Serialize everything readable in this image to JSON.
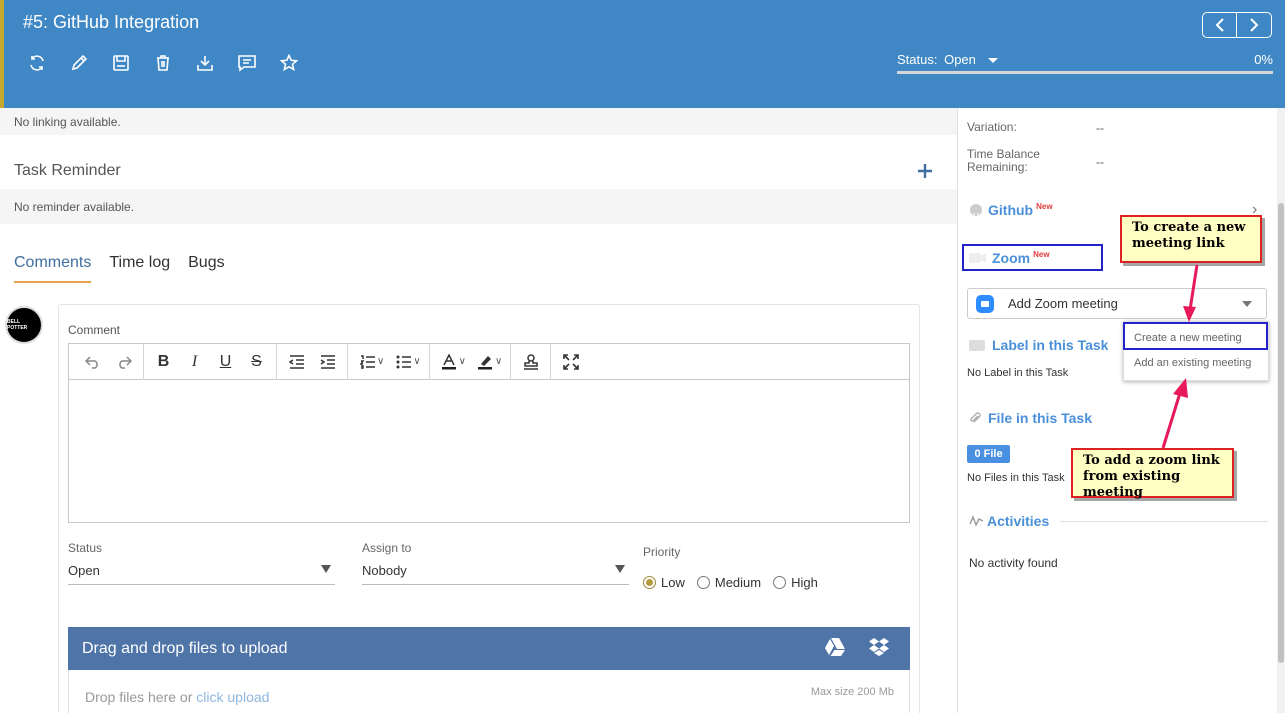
{
  "header": {
    "title": "#5: GitHub Integration",
    "toolbar_icons": [
      "refresh-icon",
      "edit-icon",
      "save-icon",
      "delete-icon",
      "download-icon",
      "comment-icon",
      "star-icon"
    ],
    "status_label": "Status:",
    "status_value": "Open",
    "progress_text": "0%",
    "progress_fraction": 0,
    "accent": "#3f88c5"
  },
  "left": {
    "linking_text": "No linking available.",
    "reminder_title": "Task Reminder",
    "reminder_text": "No reminder available.",
    "tabs": [
      "Comments",
      "Time log",
      "Bugs"
    ],
    "avatar_text": "BELL POTTER",
    "comment_label": "Comment",
    "status_label": "Status",
    "status_value": "Open",
    "assign_label": "Assign to",
    "assign_value": "Nobody",
    "priority_label": "Priority",
    "priority_options": [
      "Low",
      "Medium",
      "High"
    ],
    "priority_selected": "Low",
    "upload_title": "Drag and drop files to upload",
    "drop_text": "Drop files here or ",
    "drop_link": "click upload",
    "max_size": "Max size 200 Mb"
  },
  "right": {
    "variation_label": "Variation:",
    "variation_value": "--",
    "time_balance_label": "Time Balance Remaining:",
    "time_balance_value": "--",
    "github_title": "Github",
    "new_badge": "New",
    "zoom_title": "Zoom",
    "zoom_dropdown": "Add Zoom meeting",
    "menu_create": "Create a new meeting",
    "menu_existing": "Add an existing meeting",
    "label_title": "Label in this Task",
    "label_text": "No Label in this Task",
    "file_title": "File in this Task",
    "file_badge": "0 File",
    "file_text": "No Files in this Task",
    "activities_title": "Activities",
    "activities_text": "No activity found"
  },
  "annotations": {
    "callout_create": "To create a new meeting link",
    "callout_existing": "To add a zoom link from existing meeting"
  }
}
